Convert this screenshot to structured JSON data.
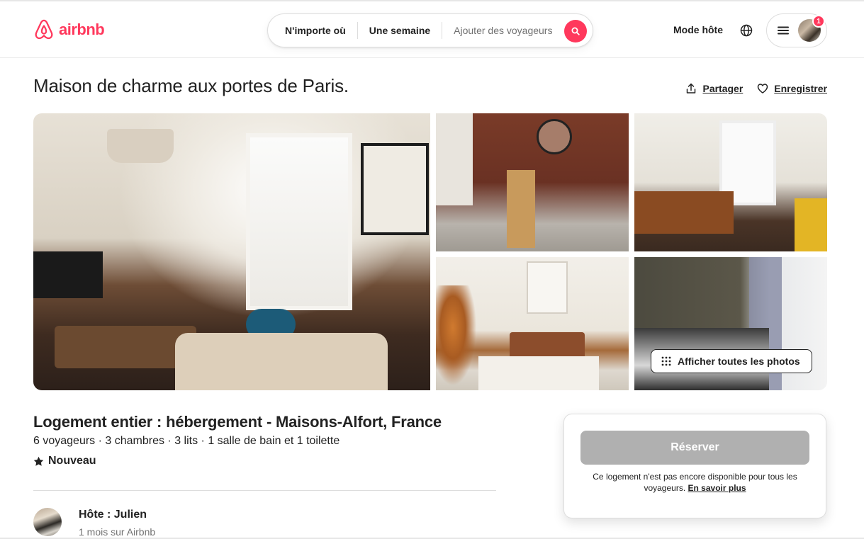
{
  "header": {
    "logo_text": "airbnb",
    "search": {
      "where": "N'importe où",
      "when": "Une semaine",
      "guests": "Ajouter des voyageurs"
    },
    "host_mode": "Mode hôte",
    "notification_count": "1"
  },
  "listing": {
    "title": "Maison de charme aux portes de Paris.",
    "share_label": "Partager",
    "save_label": "Enregistrer",
    "show_all_photos": "Afficher toutes les photos",
    "subtitle": "Logement entier : hébergement - Maisons-Alfort, France",
    "specs": "6 voyageurs · 3 chambres · 3 lits · 1 salle de bain et 1 toilette",
    "rating_label": "Nouveau"
  },
  "host": {
    "name": "Hôte : Julien",
    "tenure": "1 mois sur Airbnb"
  },
  "booking": {
    "reserve_label": "Réserver",
    "note": "Ce logement n'est pas encore disponible pour tous les voyageurs.",
    "learn_more": "En savoir plus"
  },
  "colors": {
    "brand": "#FF385C",
    "text": "#222222",
    "muted": "#717171",
    "disabled_button": "#B0B0B0"
  }
}
